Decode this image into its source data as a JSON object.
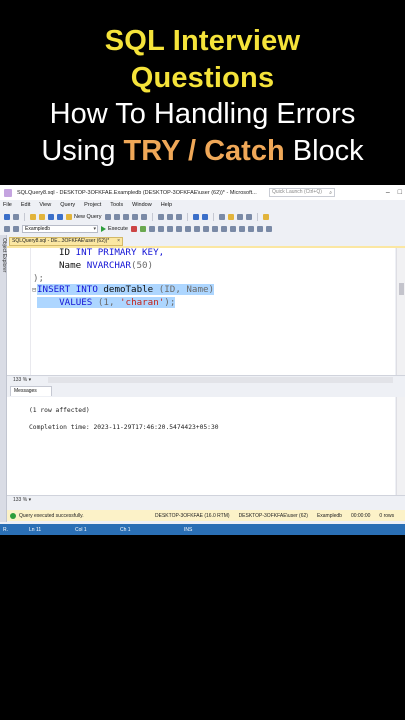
{
  "caption": {
    "line1": "SQL Interview",
    "line2": "Questions",
    "line3": "How To Handling Errors",
    "line4_pre": "Using ",
    "line4_highlight": "TRY / Catch",
    "line4_post": " Block"
  },
  "window": {
    "title": "SQLQuery8.sql - DESKTOP-3OFKFAE.Exampledb (DESKTOP-3OFKFAE\\user (62))* - Microsoft...",
    "quick_launch_placeholder": "Quick Launch (Ctrl+Q)"
  },
  "menu": [
    "File",
    "Edit",
    "View",
    "Query",
    "Project",
    "Tools",
    "Window",
    "Help"
  ],
  "toolbar": {
    "new_query_label": "New Query",
    "database": "Exampledb",
    "execute_label": "Execute"
  },
  "sidebar": {
    "object_explorer_label": "Object Explorer"
  },
  "doc_tab": {
    "label": "SQLQuery8.sql - DE...3OFKFAE\\user (62))*"
  },
  "editor": {
    "line1_name": "ID",
    "line1_type": "INT PRIMARY KEY,",
    "line2_name": "Name",
    "line2_type": "NVARCHAR",
    "line2_len": "(50)",
    "line3": ");",
    "line4_kw1": "INSERT INTO",
    "line4_table": " demoTable ",
    "line4_cols": "(ID, Name)",
    "line5_kw": "VALUES",
    "line5_open": " (1, ",
    "line5_str": "'charan'",
    "line5_close": ");"
  },
  "zoom": {
    "editor": "133 %",
    "results": "133 %"
  },
  "results": {
    "tab_label": "Messages",
    "rows_affected": "(1 row affected)",
    "completion": "Completion time: 2023-11-29T17:46:20.5474423+05:30"
  },
  "query_status": {
    "message": "Query executed successfully.",
    "server": "DESKTOP-3OFKFAE (16.0 RTM)",
    "user": "DESKTOP-3OFKFAE\\user (62)",
    "database": "Exampledb",
    "elapsed": "00:00:00",
    "rows": "0 rows"
  },
  "app_status": {
    "mode": "R.",
    "line": "Ln 11",
    "col": "Col 1",
    "ch": "Ch 1",
    "ins": "INS"
  }
}
